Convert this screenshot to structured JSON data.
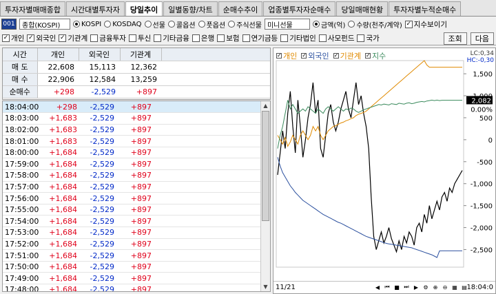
{
  "tabs": [
    "투자자별매매종합",
    "시간대별투자자",
    "당일추이",
    "일별동향/차트",
    "순매수추이",
    "업종별투자자순매수",
    "당일매매현황",
    "투자자별누적순매수"
  ],
  "active_tab": 2,
  "toolbar": {
    "code": "001",
    "market": "종합(KOSPI)",
    "radios": [
      {
        "label": "KOSPI",
        "on": true
      },
      {
        "label": "KOSDAQ",
        "on": false
      },
      {
        "label": "선물",
        "on": false
      },
      {
        "label": "콜옵션",
        "on": false
      },
      {
        "label": "풋옵션",
        "on": false
      },
      {
        "label": "주식선물",
        "on": false
      }
    ],
    "mini": "미니선물",
    "unit_radios": [
      {
        "label": "금액(억)",
        "on": true
      },
      {
        "label": "수량(천주/계약)",
        "on": false
      }
    ],
    "index_show": "지수보이기"
  },
  "filters": [
    {
      "label": "개인",
      "on": true
    },
    {
      "label": "외국인",
      "on": true
    },
    {
      "label": "기관계",
      "on": true
    },
    {
      "label": "금융투자",
      "on": false
    },
    {
      "label": "투신",
      "on": false
    },
    {
      "label": "기타금융",
      "on": false
    },
    {
      "label": "은행",
      "on": false
    },
    {
      "label": "보험",
      "on": false
    },
    {
      "label": "연기금등",
      "on": false
    },
    {
      "label": "기타법인",
      "on": false
    },
    {
      "label": "사모펀드",
      "on": false
    },
    {
      "label": "국가",
      "on": false
    }
  ],
  "buttons": {
    "query": "조회",
    "next": "다음"
  },
  "summary": {
    "headers": [
      "시간",
      "개인",
      "외국인",
      "기관계"
    ],
    "rows": [
      {
        "label": "매 도",
        "v": [
          "22,608",
          "15,113",
          "12,362"
        ]
      },
      {
        "label": "매 수",
        "v": [
          "22,906",
          "12,584",
          "13,259"
        ]
      },
      {
        "label": "순매수",
        "v": [
          "+298",
          "-2,529",
          "+897"
        ]
      }
    ]
  },
  "timelist": [
    {
      "t": "18:04:00",
      "a": "+298",
      "b": "-2,529",
      "c": "+897"
    },
    {
      "t": "18:03:00",
      "a": "+1,683",
      "b": "-2,529",
      "c": "+897"
    },
    {
      "t": "18:02:00",
      "a": "+1,683",
      "b": "-2,529",
      "c": "+897"
    },
    {
      "t": "18:01:00",
      "a": "+1,683",
      "b": "-2,529",
      "c": "+897"
    },
    {
      "t": "18:00:00",
      "a": "+1,684",
      "b": "-2,529",
      "c": "+897"
    },
    {
      "t": "17:59:00",
      "a": "+1,684",
      "b": "-2,529",
      "c": "+897"
    },
    {
      "t": "17:58:00",
      "a": "+1,684",
      "b": "-2,529",
      "c": "+897"
    },
    {
      "t": "17:57:00",
      "a": "+1,684",
      "b": "-2,529",
      "c": "+897"
    },
    {
      "t": "17:56:00",
      "a": "+1,684",
      "b": "-2,529",
      "c": "+897"
    },
    {
      "t": "17:55:00",
      "a": "+1,684",
      "b": "-2,529",
      "c": "+897"
    },
    {
      "t": "17:54:00",
      "a": "+1,684",
      "b": "-2,529",
      "c": "+897"
    },
    {
      "t": "17:53:00",
      "a": "+1,684",
      "b": "-2,529",
      "c": "+897"
    },
    {
      "t": "17:52:00",
      "a": "+1,684",
      "b": "-2,529",
      "c": "+897"
    },
    {
      "t": "17:51:00",
      "a": "+1,684",
      "b": "-2,529",
      "c": "+897"
    },
    {
      "t": "17:50:00",
      "a": "+1,684",
      "b": "-2,529",
      "c": "+897"
    },
    {
      "t": "17:49:00",
      "a": "+1,684",
      "b": "-2,529",
      "c": "+897"
    },
    {
      "t": "17:48:00",
      "a": "+1,684",
      "b": "-2,529",
      "c": "+897"
    }
  ],
  "chart": {
    "legend": [
      "개인",
      "외국인",
      "기관계",
      "지수"
    ],
    "lc": "LC:0,34",
    "hc": "HC:-0,30",
    "current_value": "2,082",
    "current_pct": "0.00%",
    "date": "11/21",
    "time": "18:04:0"
  },
  "chart_data": {
    "type": "line",
    "ylim": [
      -2900,
      1800
    ],
    "yticks": [
      1500,
      1000,
      500,
      0,
      -500,
      -1000,
      -1500,
      -2000,
      -2500
    ],
    "series": [
      {
        "name": "개인",
        "color": "#000000",
        "values": [
          -800,
          -300,
          200,
          -200,
          600,
          1100,
          300,
          -300,
          900,
          300,
          -400,
          0,
          500,
          800,
          1300,
          600,
          900,
          -200,
          -400,
          100,
          600,
          800,
          400,
          200,
          400,
          700,
          900,
          1100,
          700,
          500,
          900,
          1300,
          800,
          1000,
          600,
          300,
          -200,
          -1300,
          -2200,
          -2500,
          -2300,
          -2100,
          -2350,
          -2200,
          -2000,
          -2250,
          -2400,
          -2550,
          -2300,
          -2500,
          -2200,
          -2350,
          -2100,
          -2200,
          -2400,
          -2000,
          -1900,
          -2100,
          -1700,
          -1900,
          -1500,
          -1800,
          -1600,
          -1400,
          -1600,
          -1300,
          -1200,
          -1400,
          -1100,
          -1200,
          -1000,
          -900,
          -800,
          -700
        ]
      },
      {
        "name": "외국인",
        "color": "#2a4f9e",
        "values": [
          -400,
          -600,
          -750,
          -850,
          -950,
          -1050,
          -1120,
          -1200,
          -1260,
          -1320,
          -1380,
          -1420,
          -1460,
          -1500,
          -1540,
          -1580,
          -1620,
          -1660,
          -1700,
          -1730,
          -1760,
          -1790,
          -1820,
          -1850,
          -1880,
          -1900,
          -1930,
          -1960,
          -1990,
          -2020,
          -2050,
          -2080,
          -2110,
          -2140,
          -2170,
          -2200,
          -2220,
          -2240,
          -2260,
          -2280,
          -2300,
          -2320,
          -2340,
          -2360,
          -2370,
          -2380,
          -2390,
          -2400,
          -2410,
          -2420,
          -2430,
          -2440,
          -2450,
          -2460,
          -2480,
          -2500,
          -2520,
          -2540,
          -2560,
          -2580,
          -2600,
          -2620,
          -2650,
          -2680,
          -2530,
          -2529,
          -2529,
          -2529,
          -2529,
          -2529,
          -2529,
          -2529,
          -2529,
          -2529
        ]
      },
      {
        "name": "기관계",
        "color": "#e08a00",
        "values": [
          100,
          0,
          -100,
          50,
          -150,
          -50,
          100,
          0,
          -100,
          100,
          200,
          100,
          0,
          100,
          300,
          200,
          300,
          100,
          0,
          100,
          200,
          250,
          300,
          320,
          350,
          380,
          400,
          430,
          450,
          480,
          500,
          550,
          580,
          600,
          620,
          650,
          700,
          750,
          800,
          850,
          900,
          950,
          1000,
          1050,
          1100,
          1150,
          1200,
          1250,
          1300,
          1350,
          1400,
          1450,
          1500,
          1550,
          1600,
          1650,
          1700,
          1750,
          1800,
          1700,
          1650,
          1650,
          1650,
          1650,
          1650,
          1650,
          1650,
          1650,
          1650,
          1650,
          1650,
          1650,
          1650,
          1650
        ]
      },
      {
        "name": "지수",
        "color": "#3a8a5c",
        "values": [
          -200,
          100,
          300,
          600,
          900,
          700,
          800,
          700,
          600,
          650,
          700,
          650,
          750,
          700,
          650,
          600,
          700,
          650,
          600,
          700,
          750,
          700,
          650,
          700,
          750,
          700,
          650,
          700,
          680,
          720,
          700,
          650,
          620,
          650,
          680,
          700,
          720,
          740,
          760,
          780,
          800,
          790,
          810,
          800,
          790,
          820,
          810,
          800,
          830,
          820,
          810,
          830,
          840,
          820,
          830,
          850,
          860,
          870,
          860,
          880,
          890,
          900,
          890,
          900,
          890,
          897,
          897,
          897,
          897,
          897,
          897,
          897,
          897,
          897
        ]
      }
    ]
  }
}
